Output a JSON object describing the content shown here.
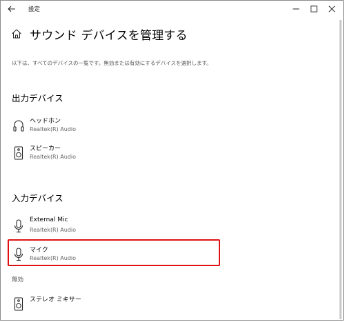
{
  "window": {
    "title": "設定"
  },
  "page": {
    "title": "サウンド デバイスを管理する",
    "description": "以下は、すべてのデバイスの一覧です。無効または有効にするデバイスを選択します。"
  },
  "output_section": {
    "title": "出力デバイス",
    "devices": [
      {
        "name": "ヘッドホン",
        "driver": "Realtek(R) Audio",
        "icon": "headphones-icon"
      },
      {
        "name": "スピーカー",
        "driver": "Realtek(R) Audio",
        "icon": "speaker-icon"
      }
    ]
  },
  "input_section": {
    "title": "入力デバイス",
    "devices": [
      {
        "name": "External Mic",
        "driver": "Realtek(R) Audio",
        "icon": "microphone-icon"
      },
      {
        "name": "マイク",
        "driver": "Realtek(R) Audio",
        "icon": "microphone-icon",
        "highlighted": true
      }
    ]
  },
  "disabled_section": {
    "label": "無効",
    "devices": [
      {
        "name": "ステレオ ミキサー",
        "driver": "",
        "icon": "speaker-icon"
      }
    ]
  },
  "colors": {
    "highlight": "#e01010",
    "text_secondary": "#666666"
  }
}
